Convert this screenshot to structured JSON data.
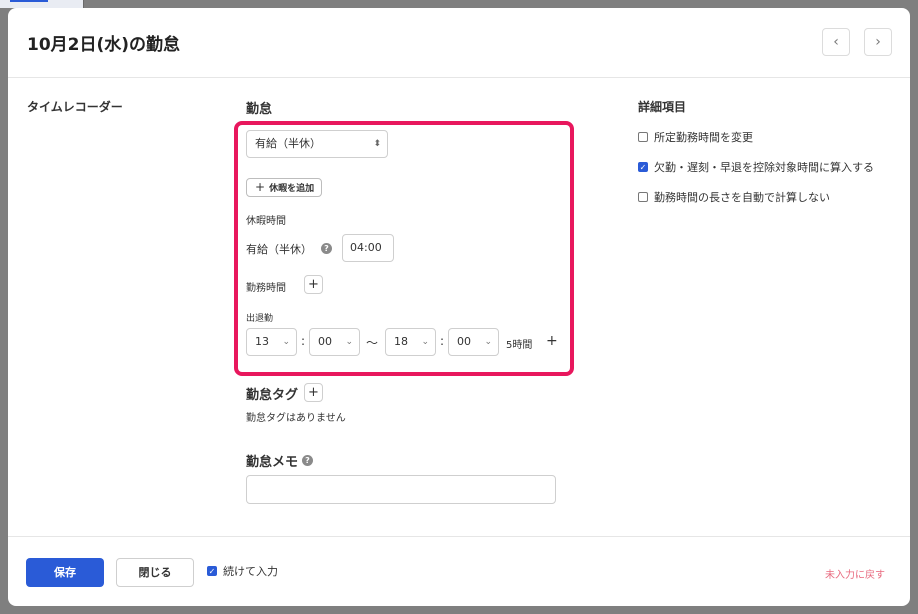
{
  "modal": {
    "title": "10月2日(水)の勤怠",
    "prev_icon": "‹",
    "next_icon": "›"
  },
  "left": {
    "label": "タイムレコーダー"
  },
  "attendance": {
    "heading": "勤怠",
    "type_select": {
      "value": "有給（半休）"
    },
    "add_leave_button": "休暇を追加",
    "leave_time_label": "休暇時間",
    "leave_item_label": "有給（半休）",
    "leave_time_value": "04:00",
    "work_time_label": "勤務時間",
    "clock_label": "出退勤",
    "start_hour": "13",
    "start_minute": "00",
    "end_hour": "18",
    "end_minute": "00",
    "tilde": "〜",
    "colon": ":",
    "duration": "5時間"
  },
  "tags": {
    "heading": "勤怠タグ",
    "empty_text": "勤怠タグはありません"
  },
  "memo": {
    "heading": "勤怠メモ",
    "value": ""
  },
  "details": {
    "heading": "詳細項目",
    "options": [
      {
        "label": "所定勤務時間を変更",
        "checked": false
      },
      {
        "label": "欠勤・遅刻・早退を控除対象時間に算入する",
        "checked": true
      },
      {
        "label": "勤務時間の長さを自動で計算しない",
        "checked": false
      }
    ]
  },
  "footer": {
    "save_label": "保存",
    "close_label": "閉じる",
    "continue_label": "続けて入力",
    "continue_checked": true,
    "reset_label": "未入力に戻す"
  },
  "colors": {
    "accent": "#2a5bd7",
    "highlight": "#e8175d",
    "link": "#e86a7f"
  }
}
